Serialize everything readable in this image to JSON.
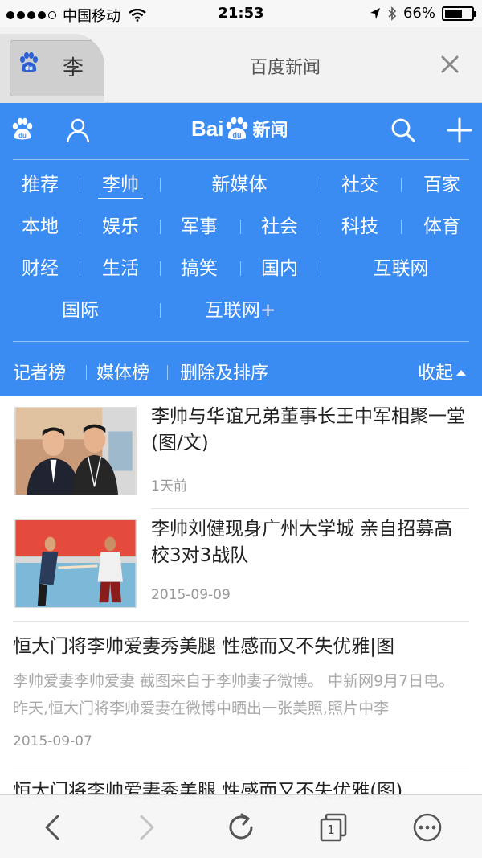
{
  "status_bar": {
    "carrier": "中国移动",
    "time": "21:53",
    "battery": "66%",
    "battery_level": 0.66
  },
  "tab": {
    "thumb_text": "李",
    "title": "百度新闻"
  },
  "header": {
    "logo_text_bai": "Bai",
    "logo_text_du": "du",
    "logo_text_news": "新闻"
  },
  "categories": {
    "row1": [
      "推荐",
      "李帅",
      "新媒体",
      "社交",
      "百家"
    ],
    "row2": [
      "本地",
      "娱乐",
      "军事",
      "社会",
      "科技",
      "体育"
    ],
    "row3": [
      "财经",
      "生活",
      "搞笑",
      "国内",
      "互联网"
    ],
    "row4": [
      "国际",
      "互联网+"
    ],
    "active": "李帅"
  },
  "subbar": {
    "reporters": "记者榜",
    "media": "媒体榜",
    "manage": "删除及排序",
    "collapse": "收起"
  },
  "news": [
    {
      "title": "李帅与华谊兄弟董事长王中军相聚一堂(图/文)",
      "time": "1天前"
    },
    {
      "title": "李帅刘健现身广州大学城 亲自招募高校3对3战队",
      "time": "2015-09-09"
    },
    {
      "title": "恒大门将李帅爱妻秀美腿 性感而又不失优雅|图",
      "desc": "李帅爱妻李帅爱妻 截图来自于李帅妻子微博。 中新网9月7日电。昨天,恒大门将李帅爱妻在微博中晒出一张美照,照片中李",
      "time": "2015-09-07"
    },
    {
      "title": "恒大门将李帅爱妻秀美腿 性感而又不失优雅(图)"
    }
  ],
  "toolbar": {
    "tab_count": "1"
  }
}
